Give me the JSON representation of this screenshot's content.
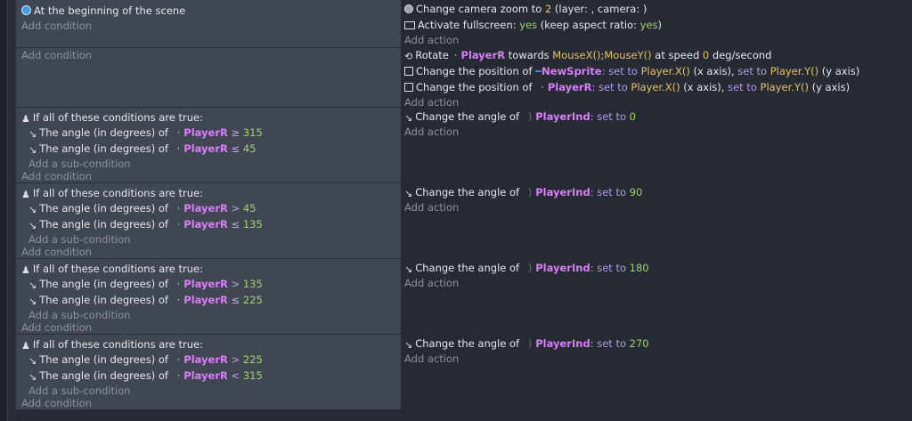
{
  "events": [
    {
      "conditions": [
        {
          "icon": "scene-icon",
          "text": "At the beginning of the scene"
        }
      ],
      "add_condition": "Add condition",
      "actions_rich": true
    }
  ],
  "ev1": {
    "cond": "At the beginning of the scene",
    "add_condition": "Add condition",
    "a1_pre": "Change camera zoom to ",
    "a1_val": "2",
    "a1_post": " (layer: , camera: )",
    "a2_pre": "Activate fullscreen: ",
    "a2_val": "yes",
    "a2_mid": " (keep aspect ratio: ",
    "a2_val2": "yes",
    "a2_post": ")",
    "add_action": "Add action"
  },
  "ev2": {
    "add_condition": "Add condition",
    "a1_pre": "Rotate",
    "a1_obj": "PlayerR",
    "a1_mid": " towards ",
    "a1_val": "MouseX();MouseY()",
    "a1_mid2": " at speed ",
    "a1_val2": "0",
    "a1_post": " deg/second",
    "a2_pre": "Change the position of ",
    "a2_obj": "NewSprite",
    "a2_set": ": set to ",
    "a2_val": "Player.X()",
    "a2_mid": " (x axis), ",
    "a2_set2": "set to ",
    "a2_val2": "Player.Y()",
    "a2_post": " (y axis)",
    "a3_pre": "Change the position of ",
    "a3_obj": "PlayerR",
    "a3_set": ": set to ",
    "a3_val": "Player.X()",
    "a3_mid": " (x axis), ",
    "a3_set2": "set to ",
    "a3_val2": "Player.Y()",
    "a3_post": " (y axis)",
    "add_action": "Add action"
  },
  "angle_events": [
    {
      "c1_op": "≥",
      "c1_val": "315",
      "c2_op": "≤",
      "c2_val": "45",
      "angle": "0"
    },
    {
      "c1_op": ">",
      "c1_val": "45",
      "c2_op": "≤",
      "c2_val": "135",
      "angle": "90"
    },
    {
      "c1_op": ">",
      "c1_val": "135",
      "c2_op": "≤",
      "c2_val": "225",
      "angle": "180"
    },
    {
      "c1_op": ">",
      "c1_val": "225",
      "c2_op": "<",
      "c2_val": "315",
      "angle": "270"
    }
  ],
  "common": {
    "group_label": "If all of these conditions are true:",
    "angle_cond_pre": "The angle (in degrees) of ",
    "angle_obj": "PlayerR",
    "add_sub": "Add a sub-condition",
    "add_condition": "Add condition",
    "act_pre": "Change the angle of ",
    "act_obj": "PlayerInd",
    "act_set": ": set to ",
    "add_action": "Add action"
  }
}
